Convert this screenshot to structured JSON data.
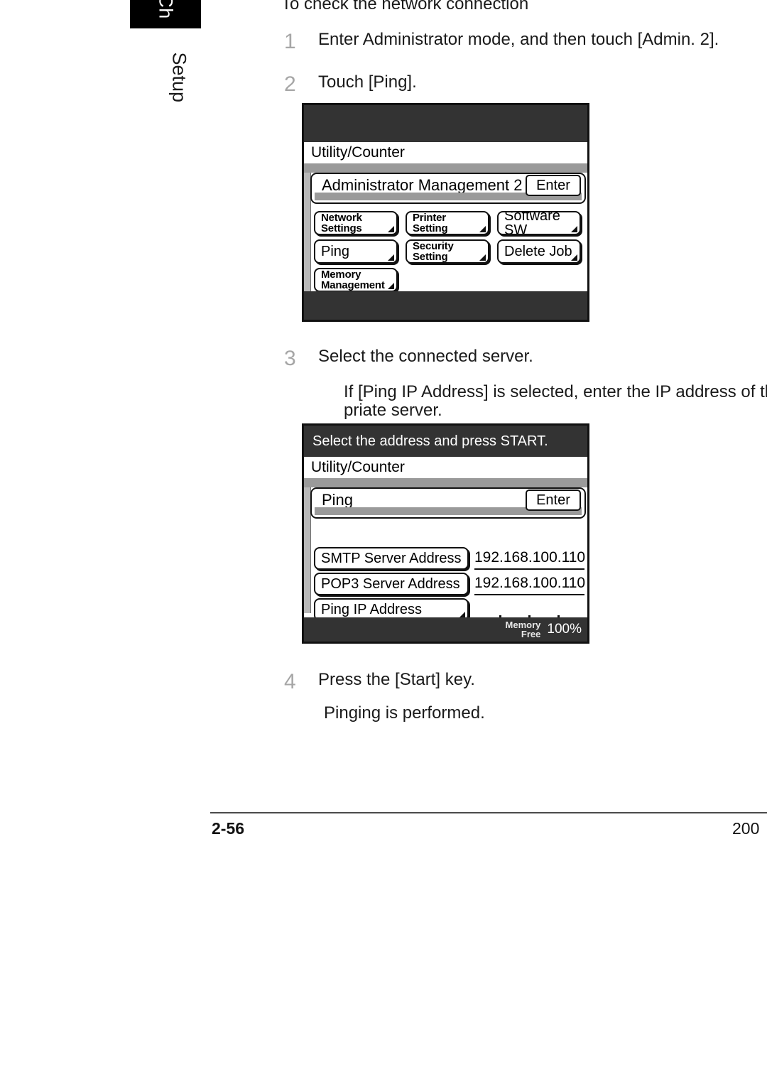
{
  "tab": {
    "chapter_label": "Ch",
    "section_label": "Setup"
  },
  "heading": "To check the network connection",
  "steps": [
    {
      "num": "1",
      "text": "Enter Administrator mode, and then touch [Admin. 2]."
    },
    {
      "num": "2",
      "text": "Touch [Ping]."
    },
    {
      "num": "3",
      "text": "Select the connected server."
    },
    {
      "num": "4",
      "text": "Press the [Start] key."
    }
  ],
  "step3_note_line1": "If [Ping IP Address] is selected, enter the IP address of the",
  "step3_note_line2": "priate server.",
  "step4_note": "Pinging is performed.",
  "panel1": {
    "message_bar": "",
    "title_bar": "Utility/Counter",
    "section_title": "Administrator Management 2",
    "enter_label": "Enter",
    "keys": [
      {
        "label": "Network\nSettings",
        "size": "small",
        "corner": true
      },
      {
        "label": "Printer\nSetting",
        "size": "small",
        "corner": true
      },
      {
        "label": "Software SW",
        "size": "large",
        "corner": true
      },
      {
        "label": "Ping",
        "size": "large",
        "corner": true
      },
      {
        "label": "Security\nSetting",
        "size": "small",
        "corner": true
      },
      {
        "label": "Delete Job",
        "size": "large",
        "corner": true
      },
      {
        "label": "Memory\nManagement",
        "size": "small",
        "corner": true
      }
    ]
  },
  "panel2": {
    "message_bar": "Select the address and press START.",
    "title_bar": "Utility/Counter",
    "section_title": "Ping",
    "enter_label": "Enter",
    "rows": [
      {
        "key": "SMTP Server Address",
        "value": "192.168.100.110",
        "corner": false
      },
      {
        "key": "POP3 Server Address",
        "value": "192.168.100.110",
        "corner": false
      },
      {
        "key": "Ping IP Address",
        "value": "",
        "corner": true
      }
    ],
    "memory_label_line1": "Memory",
    "memory_label_line2": "Free",
    "memory_value": "100%"
  },
  "footer": {
    "page_number": "2-56",
    "right_text": "200"
  },
  "colors": {
    "panel_dark": "#333333",
    "panel_grey": "#9a9a9a",
    "step_number": "#a6a6a6",
    "ink": "#111111"
  }
}
